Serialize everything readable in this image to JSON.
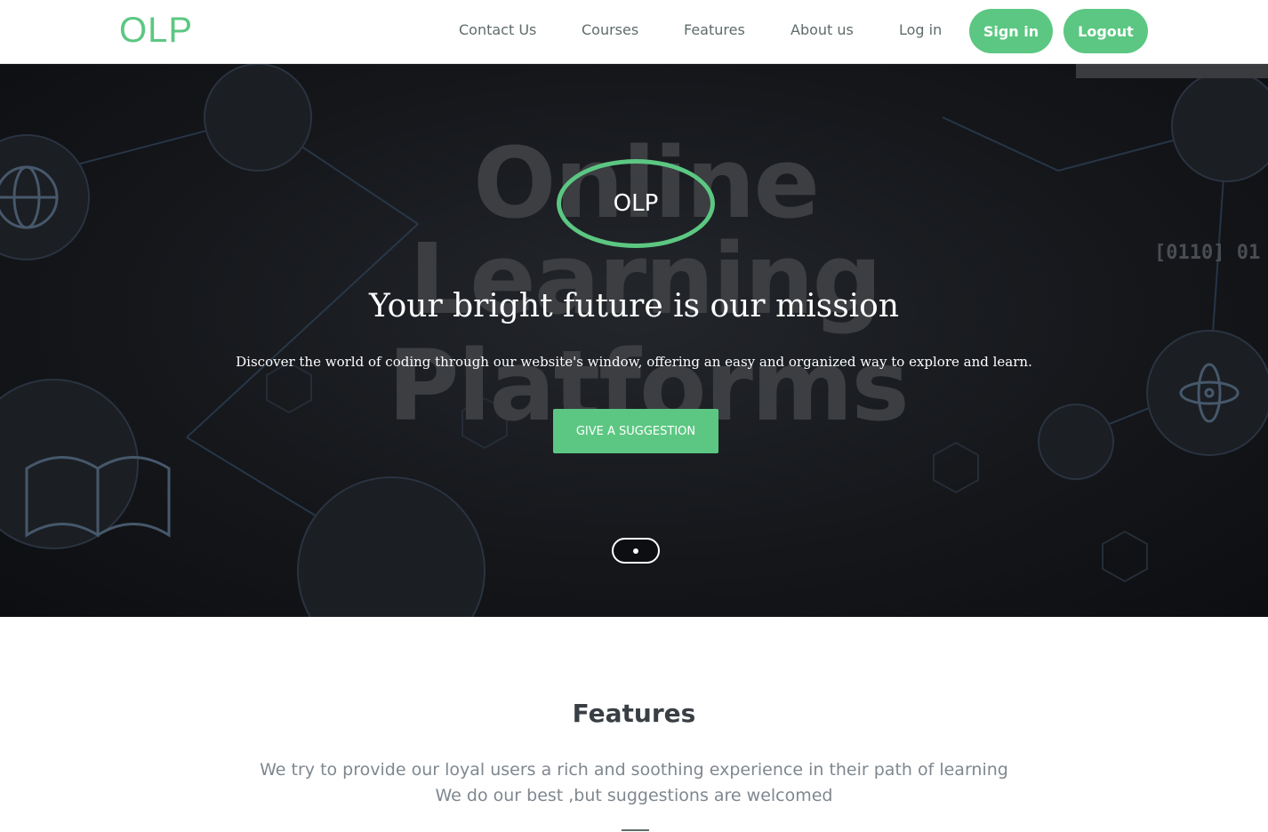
{
  "header": {
    "logo": "OLP",
    "nav": [
      {
        "label": "Contact Us"
      },
      {
        "label": "Courses"
      },
      {
        "label": "Features"
      },
      {
        "label": "About us"
      },
      {
        "label": "Log in"
      }
    ],
    "sign_in": "Sign in",
    "logout": "Logout"
  },
  "hero": {
    "background_words": [
      "Online",
      "Learning",
      "Platforms"
    ],
    "binary_text": "[0110] 01",
    "badge": "OLP",
    "title": "Your bright future is our mission",
    "subtitle": "Discover the world of coding through our website's window, offering an easy and organized way to explore and learn.",
    "cta": "GIVE A SUGGESTION"
  },
  "features": {
    "title": "Features",
    "lines": [
      "We try to provide our loyal users a rich and soothing experience in their path of learning",
      "We do our best ,but suggestions are welcomed"
    ]
  },
  "colors": {
    "accent": "#5cc782",
    "nav_text": "#5f6b6b",
    "hero_bg": "#15171b"
  }
}
